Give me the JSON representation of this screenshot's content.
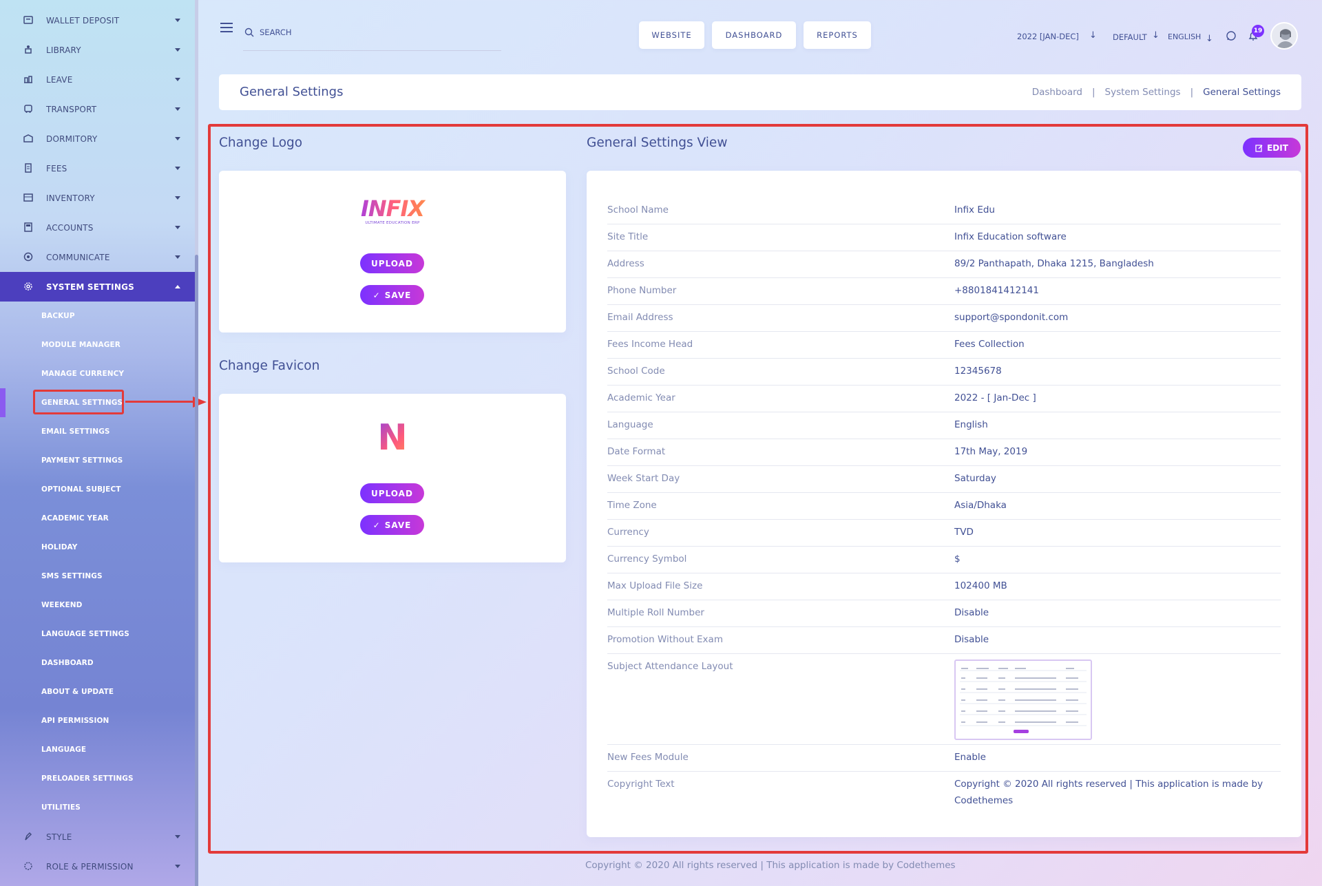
{
  "sidebar": {
    "items": [
      {
        "label": "WALLET DEPOSIT",
        "icon": "wallet-icon"
      },
      {
        "label": "LIBRARY",
        "icon": "library-icon"
      },
      {
        "label": "LEAVE",
        "icon": "leave-icon"
      },
      {
        "label": "TRANSPORT",
        "icon": "bus-icon"
      },
      {
        "label": "DORMITORY",
        "icon": "dormitory-icon"
      },
      {
        "label": "FEES",
        "icon": "fees-icon"
      },
      {
        "label": "INVENTORY",
        "icon": "inventory-icon"
      },
      {
        "label": "ACCOUNTS",
        "icon": "accounts-icon"
      },
      {
        "label": "COMMUNICATE",
        "icon": "communicate-icon"
      },
      {
        "label": "SYSTEM SETTINGS",
        "icon": "gear-icon"
      }
    ],
    "sub_items": [
      "BACKUP",
      "MODULE MANAGER",
      "MANAGE CURRENCY",
      "GENERAL SETTINGS",
      "EMAIL SETTINGS",
      "PAYMENT SETTINGS",
      "OPTIONAL SUBJECT",
      "ACADEMIC YEAR",
      "HOLIDAY",
      "SMS SETTINGS",
      "WEEKEND",
      "LANGUAGE SETTINGS",
      "DASHBOARD",
      "ABOUT & UPDATE",
      "API PERMISSION",
      "LANGUAGE",
      "PRELOADER SETTINGS",
      "UTILITIES"
    ],
    "bottom_items": [
      {
        "label": "STYLE",
        "icon": "style-icon"
      },
      {
        "label": "ROLE & PERMISSION",
        "icon": "role-icon"
      }
    ]
  },
  "header": {
    "search_placeholder": "SEARCH",
    "buttons": [
      "WEBSITE",
      "DASHBOARD",
      "REPORTS"
    ],
    "academic_year": "2022 [JAN-DEC]",
    "theme": "DEFAULT",
    "language": "ENGLISH",
    "notification_count": "19"
  },
  "title_bar": {
    "title": "General Settings",
    "breadcrumb": [
      "Dashboard",
      "System Settings",
      "General Settings"
    ],
    "separator": "|"
  },
  "logo_section": {
    "title": "Change Logo",
    "logo_text": "INFIX",
    "logo_tagline": "ULTIMATE EDUCATION ERP",
    "upload_label": "UPLOAD",
    "save_label": "SAVE"
  },
  "favicon_section": {
    "title": "Change Favicon",
    "favicon_letter": "N",
    "upload_label": "UPLOAD",
    "save_label": "SAVE"
  },
  "settings_view": {
    "title": "General Settings View",
    "edit_label": "EDIT",
    "rows": [
      {
        "key": "School Name",
        "value": "Infix Edu"
      },
      {
        "key": "Site Title",
        "value": "Infix Education software"
      },
      {
        "key": "Address",
        "value": "89/2 Panthapath, Dhaka 1215, Bangladesh"
      },
      {
        "key": "Phone Number",
        "value": "+8801841412141"
      },
      {
        "key": "Email Address",
        "value": "support@spondonit.com"
      },
      {
        "key": "Fees Income Head",
        "value": "Fees Collection"
      },
      {
        "key": "School Code",
        "value": "12345678"
      },
      {
        "key": "Academic Year",
        "value": "2022 - [ Jan-Dec ]"
      },
      {
        "key": "Language",
        "value": "English"
      },
      {
        "key": "Date Format",
        "value": "17th May, 2019"
      },
      {
        "key": "Week Start Day",
        "value": "Saturday"
      },
      {
        "key": "Time Zone",
        "value": "Asia/Dhaka"
      },
      {
        "key": "Currency",
        "value": "TVD"
      },
      {
        "key": "Currency Symbol",
        "value": "$"
      },
      {
        "key": "Max Upload File Size",
        "value": "102400 MB"
      },
      {
        "key": "Multiple Roll Number",
        "value": "Disable"
      },
      {
        "key": "Promotion Without Exam",
        "value": "Disable"
      },
      {
        "key": "Subject Attendance Layout",
        "value": ""
      },
      {
        "key": "New Fees Module",
        "value": "Enable"
      },
      {
        "key": "Copyright Text",
        "value": "Copyright © 2020 All rights reserved | This application is made by Codethemes"
      }
    ]
  },
  "footer": {
    "text": "Copyright © 2020 All rights reserved | This application is made by Codethemes"
  },
  "colors": {
    "accent": "#7c32ff",
    "accent2": "#c738d8",
    "text": "#415094",
    "highlight": "#e33a3a",
    "active_menu": "#4c3fbe"
  }
}
